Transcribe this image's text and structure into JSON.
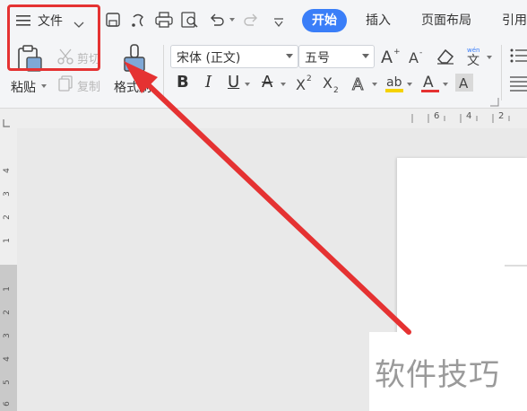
{
  "menu": {
    "file_label": "文件"
  },
  "tabs": [
    {
      "label": "开始",
      "active": true
    },
    {
      "label": "插入"
    },
    {
      "label": "页面布局"
    },
    {
      "label": "引用"
    }
  ],
  "clipboard": {
    "paste_label": "粘贴",
    "cut_label": "剪切",
    "copy_label": "复制",
    "format_painter_label": "格式刷"
  },
  "font": {
    "family": "宋体 (正文)",
    "size": "五号"
  },
  "rulers": {
    "horizontal_ticks": [
      "6",
      "4",
      "2"
    ],
    "vertical_ticks": [
      "4",
      "3",
      "2",
      "1",
      "1",
      "2",
      "3",
      "4",
      "5",
      "6"
    ]
  },
  "watermark": {
    "text": "软件技巧"
  },
  "colors": {
    "accent": "#3a7ef8",
    "highlight_red": "#e53232",
    "font_color": "#e53232",
    "highlight_yellow": "#f5d200"
  }
}
